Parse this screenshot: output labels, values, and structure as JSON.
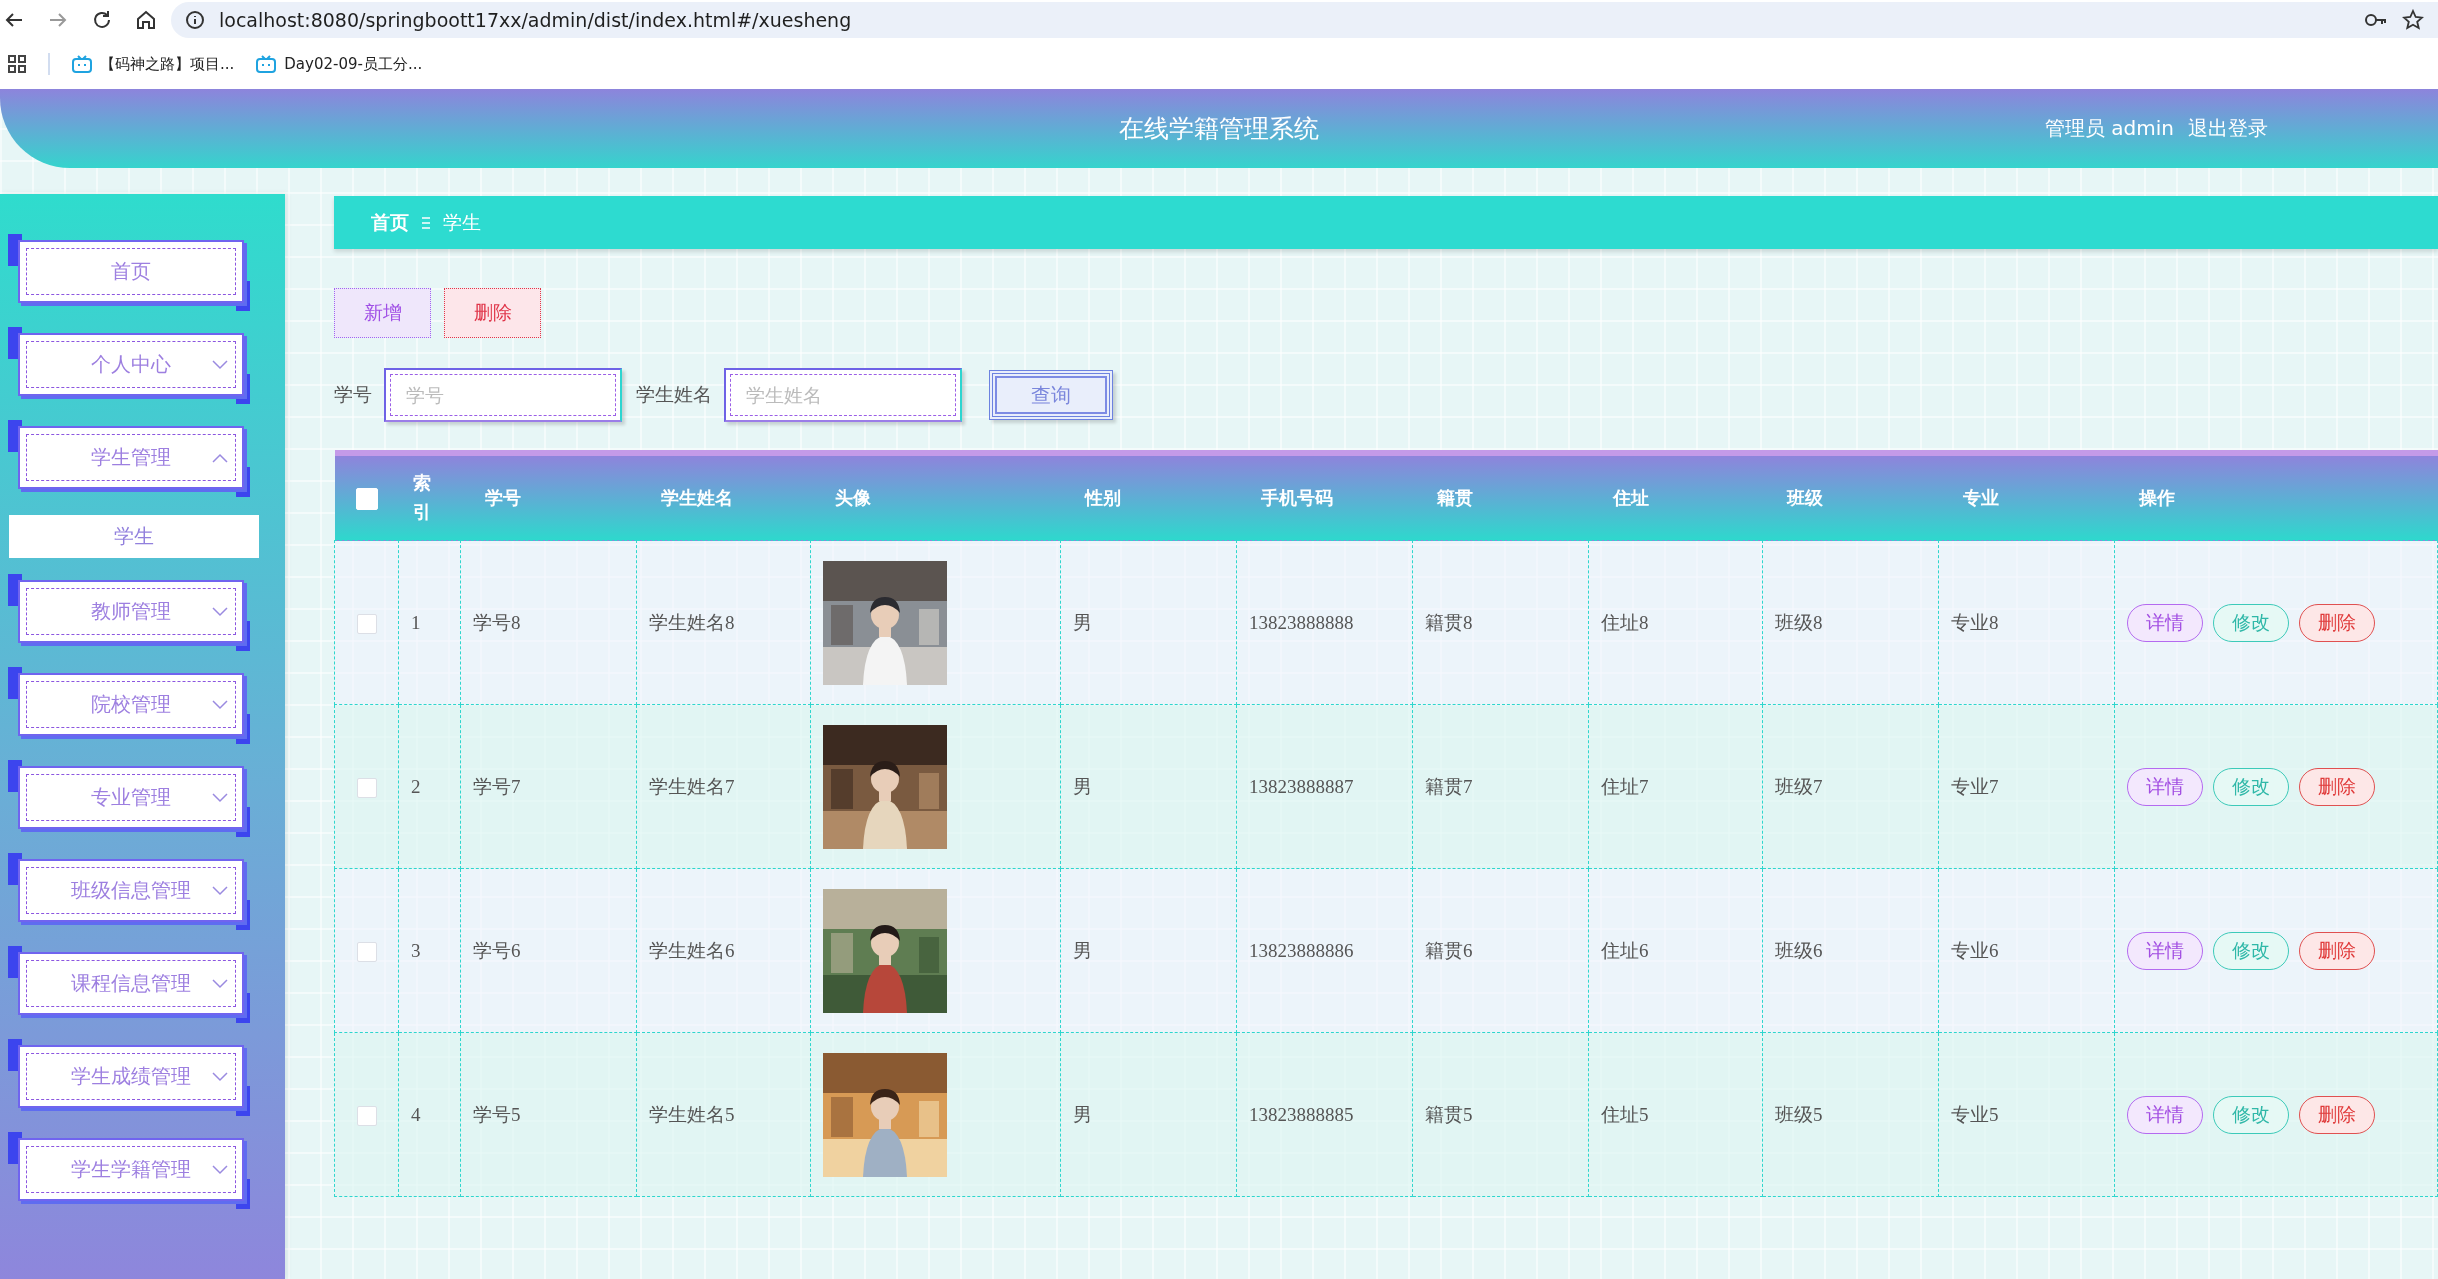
{
  "browser": {
    "url": "localhost:8080/springboott17xx/admin/dist/index.html#/xuesheng",
    "bookmarks": [
      "【码神之路】项目...",
      "Day02-09-员工分..."
    ]
  },
  "header": {
    "title": "在线学籍管理系统",
    "user": "管理员 admin",
    "logout": "退出登录"
  },
  "sidebar": {
    "items": [
      {
        "label": "首页",
        "kind": "link"
      },
      {
        "label": "个人中心",
        "kind": "submenu",
        "expanded": false
      },
      {
        "label": "学生管理",
        "kind": "submenu",
        "expanded": true,
        "children": [
          {
            "label": "学生",
            "selected": true
          }
        ]
      },
      {
        "label": "教师管理",
        "kind": "submenu",
        "expanded": false
      },
      {
        "label": "院校管理",
        "kind": "submenu",
        "expanded": false
      },
      {
        "label": "专业管理",
        "kind": "submenu",
        "expanded": false
      },
      {
        "label": "班级信息管理",
        "kind": "submenu",
        "expanded": false
      },
      {
        "label": "课程信息管理",
        "kind": "submenu",
        "expanded": false
      },
      {
        "label": "学生成绩管理",
        "kind": "submenu",
        "expanded": false
      },
      {
        "label": "学生学籍管理",
        "kind": "submenu",
        "expanded": false
      }
    ]
  },
  "breadcrumb": [
    "首页",
    "学生"
  ],
  "toolbar": [
    {
      "label": "新增",
      "kind": "add"
    },
    {
      "label": "删除",
      "kind": "delete"
    }
  ],
  "search": {
    "fields": [
      {
        "label": "学号",
        "placeholder": "学号"
      },
      {
        "label": "学生姓名",
        "placeholder": "学生姓名"
      }
    ],
    "button": "查询"
  },
  "table": {
    "select_all": false,
    "columns": [
      "索引",
      "学号",
      "学生姓名",
      "头像",
      "性别",
      "手机号码",
      "籍贯",
      "住址",
      "班级",
      "专业",
      "操作"
    ],
    "rows": [
      {
        "checked": false,
        "cells": [
          "1",
          "学号8",
          "学生姓名8",
          {
            "kind": "picture"
          },
          "男",
          "13823888888",
          "籍贯8",
          "住址8",
          "班级8",
          "专业8"
        ],
        "actions": [
          {
            "label": "详情",
            "kind": "detail"
          },
          {
            "label": "修改",
            "kind": "edit"
          },
          {
            "label": "删除",
            "kind": "delete"
          }
        ]
      },
      {
        "checked": false,
        "cells": [
          "2",
          "学号7",
          "学生姓名7",
          {
            "kind": "picture"
          },
          "男",
          "13823888887",
          "籍贯7",
          "住址7",
          "班级7",
          "专业7"
        ],
        "actions": [
          {
            "label": "详情",
            "kind": "detail"
          },
          {
            "label": "修改",
            "kind": "edit"
          },
          {
            "label": "删除",
            "kind": "delete"
          }
        ]
      },
      {
        "checked": false,
        "cells": [
          "3",
          "学号6",
          "学生姓名6",
          {
            "kind": "picture"
          },
          "男",
          "13823888886",
          "籍贯6",
          "住址6",
          "班级6",
          "专业6"
        ],
        "actions": [
          {
            "label": "详情",
            "kind": "detail"
          },
          {
            "label": "修改",
            "kind": "edit"
          },
          {
            "label": "删除",
            "kind": "delete"
          }
        ]
      },
      {
        "checked": false,
        "cells": [
          "4",
          "学号5",
          "学生姓名5",
          {
            "kind": "picture"
          },
          "男",
          "13823888885",
          "籍贯5",
          "住址5",
          "班级5",
          "专业5"
        ],
        "actions": [
          {
            "label": "详情",
            "kind": "detail"
          },
          {
            "label": "修改",
            "kind": "edit"
          },
          {
            "label": "删除",
            "kind": "delete"
          }
        ]
      }
    ]
  }
}
